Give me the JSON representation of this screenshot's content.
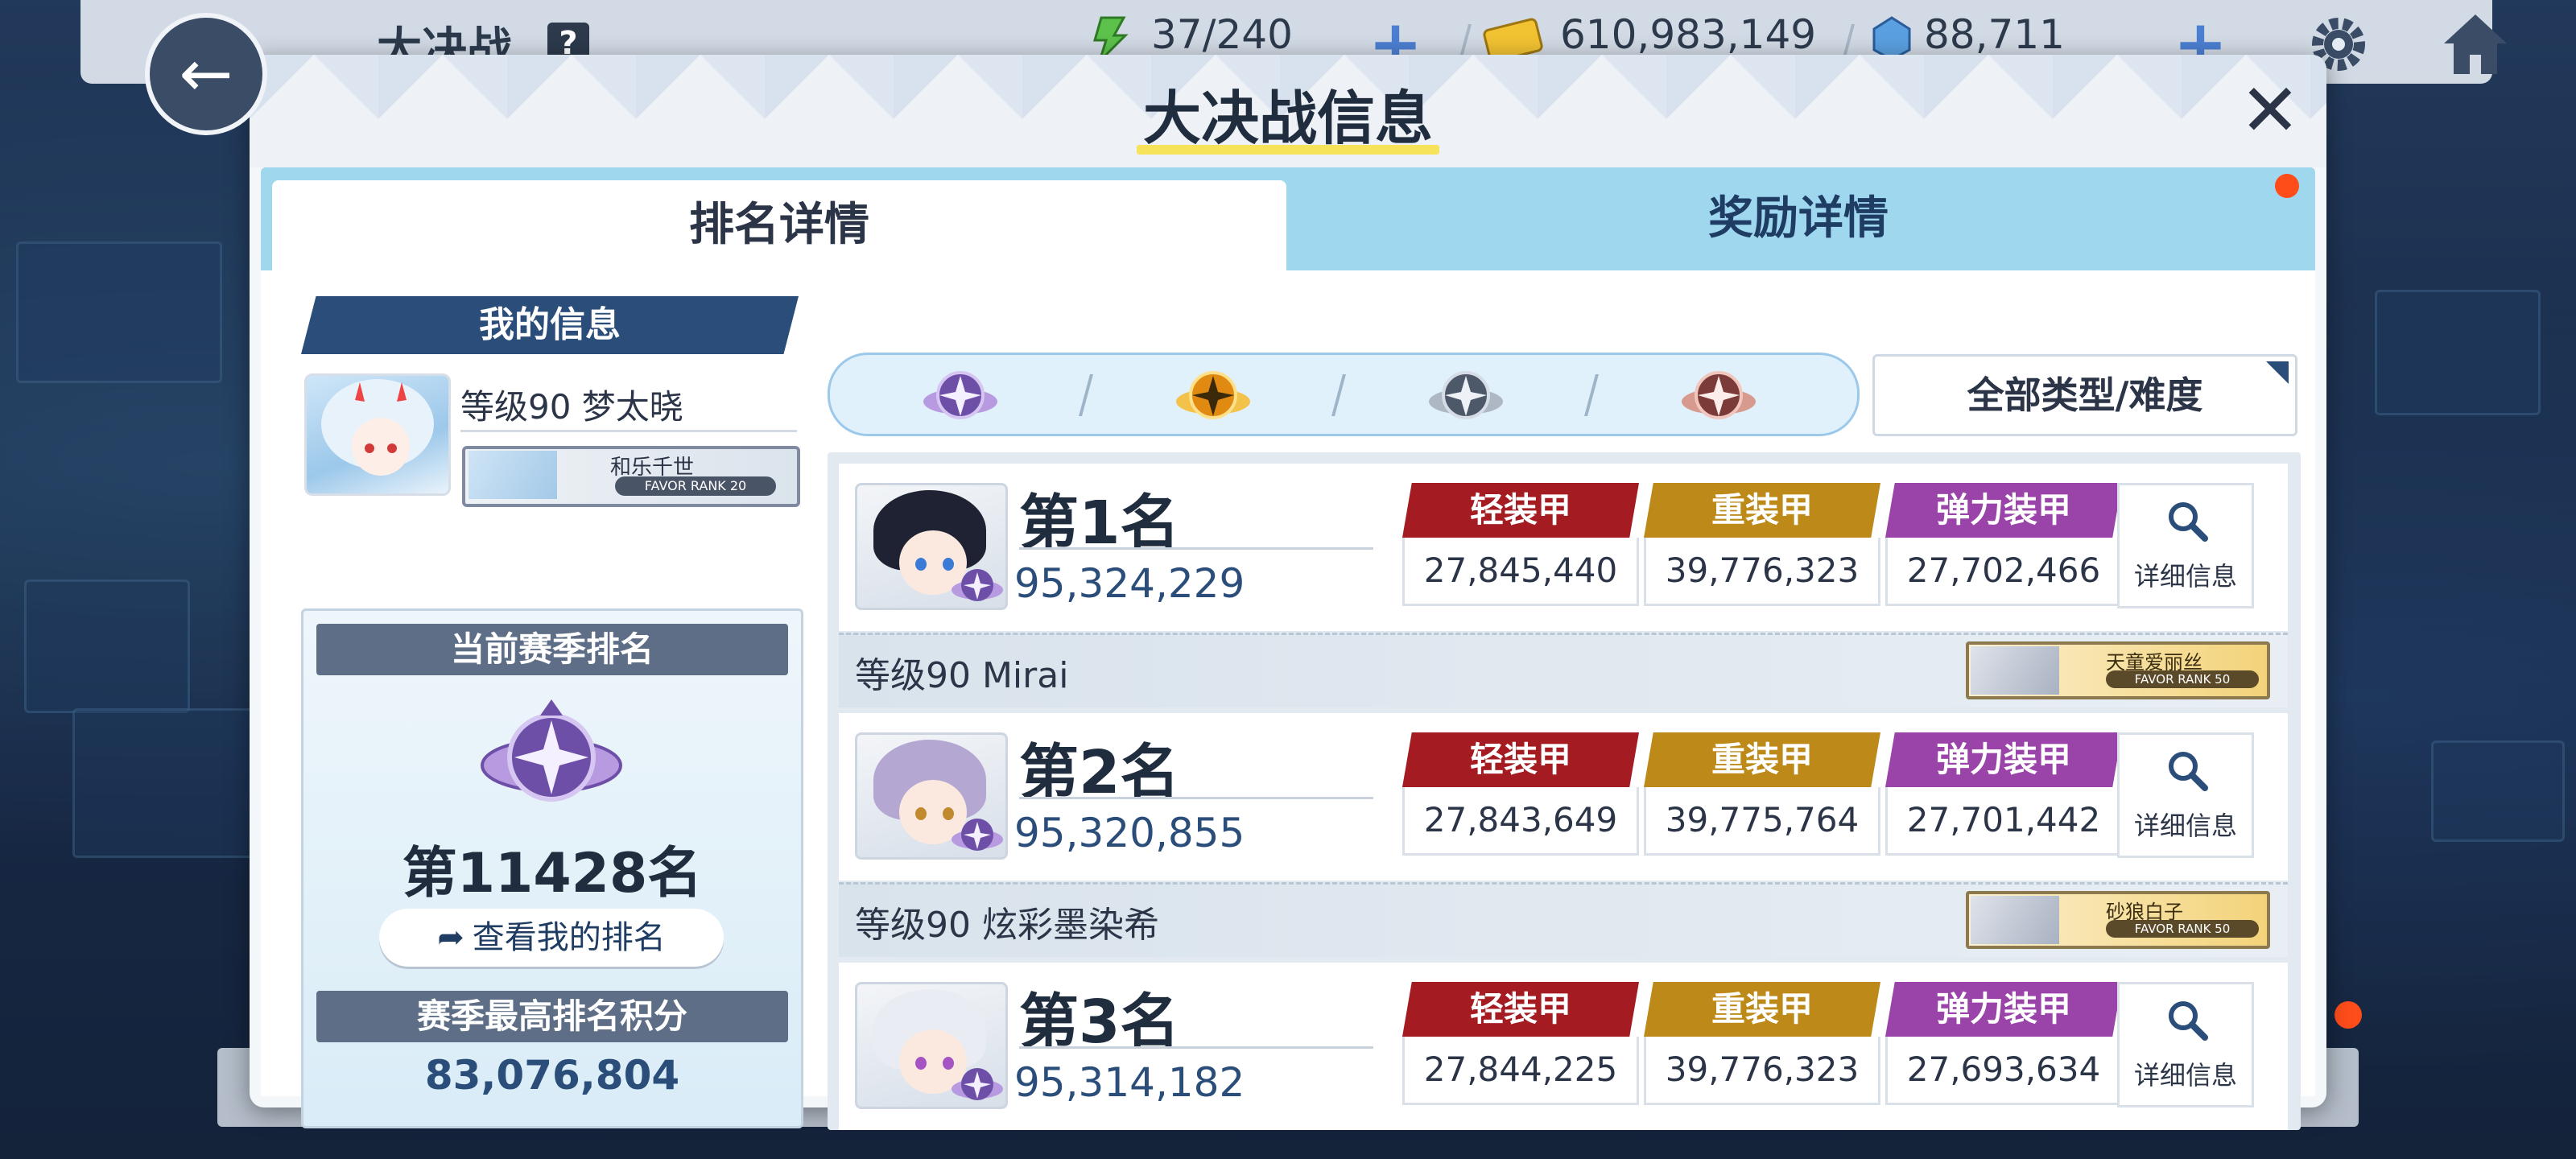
{
  "topbar": {
    "title": "大决战",
    "help": "?",
    "stamina": "37/240",
    "credits": "610,983,149",
    "gems": "88,711"
  },
  "modal": {
    "title": "大决战信息",
    "tabs": {
      "rank": "排名详情",
      "reward": "奖励详情"
    }
  },
  "my_info": {
    "header": "我的信息",
    "name": "等级90 梦太晓",
    "favor": {
      "student": "和乐千世",
      "rank": "FAVOR RANK 20"
    },
    "season_header": "当前赛季排名",
    "season_rank": "第11428名",
    "view_rank_button": "查看我的排名",
    "best_header": "赛季最高排名积分",
    "best_score": "83,076,804"
  },
  "filter": {
    "emblems": [
      "purple-emblem-icon",
      "gold-emblem-icon",
      "silver-emblem-icon",
      "bronze-emblem-icon"
    ],
    "type_label": "全部类型/难度"
  },
  "armor_labels": {
    "light": "轻装甲",
    "heavy": "重装甲",
    "elastic": "弹力装甲"
  },
  "detail_label": "详细信息",
  "rankings": [
    {
      "rank": "第1名",
      "score": "95,324,229",
      "light": "27,845,440",
      "heavy": "39,776,323",
      "elastic": "27,702,466",
      "player": "等级90  Mirai",
      "favor_student": "天童爱丽丝",
      "favor_rank": "FAVOR RANK 50"
    },
    {
      "rank": "第2名",
      "score": "95,320,855",
      "light": "27,843,649",
      "heavy": "39,775,764",
      "elastic": "27,701,442",
      "player": "等级90  炫彩墨染希",
      "favor_student": "砂狼白子",
      "favor_rank": "FAVOR RANK 50"
    },
    {
      "rank": "第3名",
      "score": "95,314,182",
      "light": "27,844,225",
      "heavy": "39,776,323",
      "elastic": "27,693,634"
    }
  ],
  "colors": {
    "light_armor": "#a41c22",
    "heavy_armor": "#bd8a19",
    "elastic_armor": "#9a43a8",
    "header_navy": "#2a4d7a",
    "tab_blue": "#9fd7ef"
  }
}
